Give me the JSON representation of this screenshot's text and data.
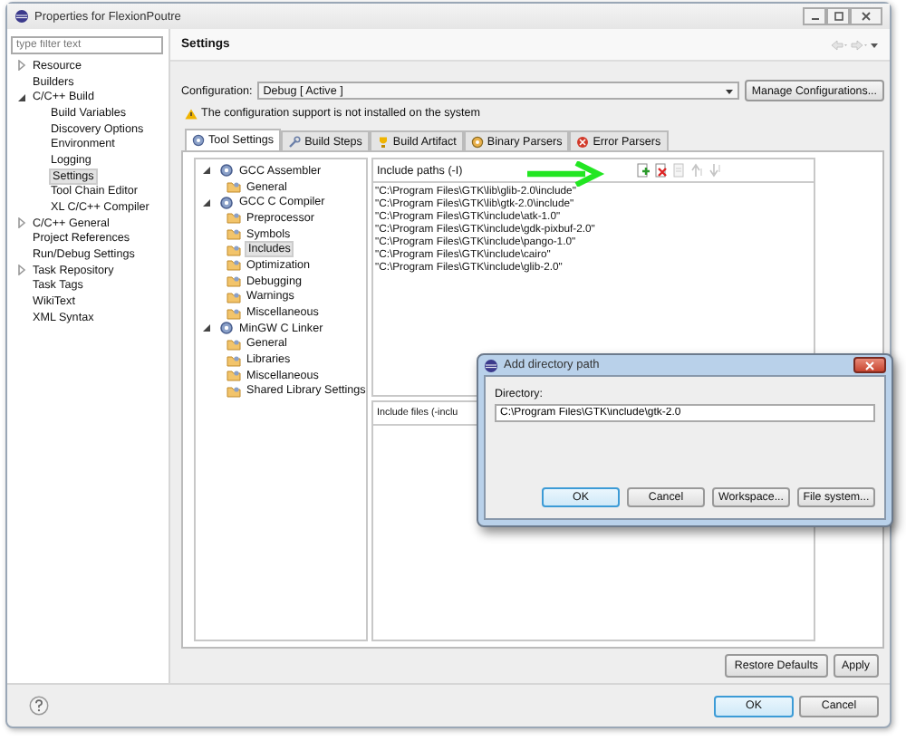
{
  "window": {
    "title": "Properties for FlexionPoutre"
  },
  "filter": {
    "placeholder": "type filter text"
  },
  "nav": [
    {
      "label": "Resource",
      "expanded": false,
      "selected": false
    },
    {
      "label": "Builders",
      "selected": false
    },
    {
      "label": "C/C++ Build",
      "expanded": true,
      "selected": false,
      "children": [
        {
          "label": "Build Variables",
          "selected": false
        },
        {
          "label": "Discovery Options",
          "selected": false
        },
        {
          "label": "Environment",
          "selected": false
        },
        {
          "label": "Logging",
          "selected": false
        },
        {
          "label": "Settings",
          "selected": true
        },
        {
          "label": "Tool Chain Editor",
          "selected": false
        },
        {
          "label": "XL C/C++ Compiler",
          "selected": false
        }
      ]
    },
    {
      "label": "C/C++ General",
      "expanded": false,
      "selected": false
    },
    {
      "label": "Project References",
      "selected": false
    },
    {
      "label": "Run/Debug Settings",
      "selected": false
    },
    {
      "label": "Task Repository",
      "expanded": false,
      "selected": false
    },
    {
      "label": "Task Tags",
      "selected": false
    },
    {
      "label": "WikiText",
      "selected": false
    },
    {
      "label": "XML Syntax",
      "selected": false
    }
  ],
  "page": {
    "title": "Settings"
  },
  "configuration": {
    "label": "Configuration:",
    "value": "Debug  [ Active ]",
    "button": "Manage Configurations..."
  },
  "warning": "The configuration support is not installed on the system",
  "tabs": [
    {
      "label": "Tool Settings",
      "kind": "tool",
      "selected": true
    },
    {
      "label": "Build Steps",
      "kind": "steps",
      "selected": false
    },
    {
      "label": "Build Artifact",
      "kind": "artifact",
      "selected": false
    },
    {
      "label": "Binary Parsers",
      "kind": "binary",
      "selected": false
    },
    {
      "label": "Error Parsers",
      "kind": "error",
      "selected": false
    }
  ],
  "tool_tree": [
    {
      "label": "GCC Assembler",
      "expanded": true,
      "selected": false,
      "children": [
        {
          "label": "General",
          "selected": false
        }
      ]
    },
    {
      "label": "GCC C Compiler",
      "expanded": true,
      "selected": false,
      "children": [
        {
          "label": "Preprocessor",
          "selected": false
        },
        {
          "label": "Symbols",
          "selected": false
        },
        {
          "label": "Includes",
          "selected": true
        },
        {
          "label": "Optimization",
          "selected": false
        },
        {
          "label": "Debugging",
          "selected": false
        },
        {
          "label": "Warnings",
          "selected": false
        },
        {
          "label": "Miscellaneous",
          "selected": false
        }
      ]
    },
    {
      "label": "MinGW C Linker",
      "expanded": true,
      "selected": false,
      "children": [
        {
          "label": "General",
          "selected": false
        },
        {
          "label": "Libraries",
          "selected": false
        },
        {
          "label": "Miscellaneous",
          "selected": false
        },
        {
          "label": "Shared Library Settings",
          "selected": false
        }
      ]
    }
  ],
  "include_paths": {
    "label": "Include paths (-I)",
    "toolbar": [
      {
        "kind": "add",
        "disabled": false
      },
      {
        "kind": "delete",
        "disabled": false
      },
      {
        "kind": "edit",
        "disabled": true
      },
      {
        "kind": "up",
        "disabled": true
      },
      {
        "kind": "down",
        "disabled": true
      }
    ],
    "items": [
      "\"C:\\Program Files\\GTK\\lib\\glib-2.0\\include\"",
      "\"C:\\Program Files\\GTK\\lib\\gtk-2.0\\include\"",
      "\"C:\\Program Files\\GTK\\include\\atk-1.0\"",
      "\"C:\\Program Files\\GTK\\include\\gdk-pixbuf-2.0\"",
      "\"C:\\Program Files\\GTK\\include\\pango-1.0\"",
      "\"C:\\Program Files\\GTK\\include\\cairo\"",
      "\"C:\\Program Files\\GTK\\include\\glib-2.0\""
    ]
  },
  "include_files": {
    "label": "Include files (-inclu"
  },
  "page_buttons": [
    "Restore Defaults",
    "Apply"
  ],
  "buttons": [
    "OK",
    "Cancel"
  ],
  "dialog": {
    "title": "Add directory path",
    "label": "Directory:",
    "value": "C:\\Program Files\\GTK\\include\\gtk-2.0",
    "buttons": [
      "OK",
      "Cancel",
      "Workspace...",
      "File system..."
    ]
  }
}
